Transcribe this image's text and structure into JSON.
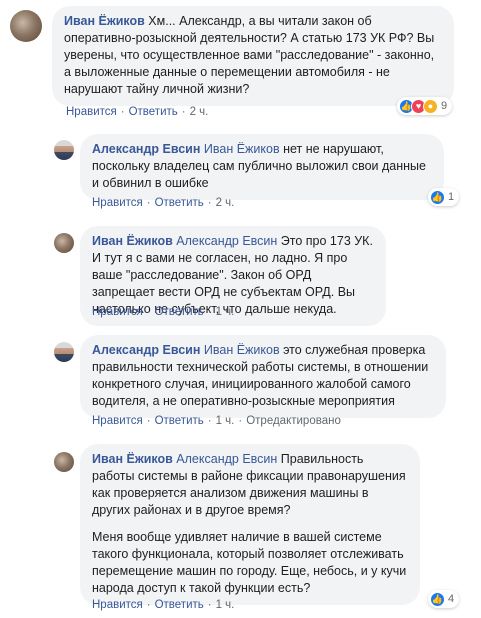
{
  "comments": [
    {
      "author": "Иван Ёжиков",
      "mention": "",
      "text": "Хм... Александр, а вы читали закон об оперативно-розыскной деятельности? А статью 173 УК РФ? Вы уверены, что осуществленное вами \"расследование\" - законно, а выложенные данные о перемещении автомобиля - не нарушают тайну личной жизни?",
      "text2": "",
      "like": "Нравится",
      "reply": "Ответить",
      "time": "2 ч.",
      "edited": "",
      "reaction_count": "9",
      "reactions": [
        "like-icon",
        "love-icon",
        "wow-icon"
      ]
    },
    {
      "author": "Александр Евсин",
      "mention": "Иван Ёжиков",
      "text": " нет не нарушают, поскольку владелец сам публично выложил свои данные и обвинил в ошибке",
      "text2": "",
      "like": "Нравится",
      "reply": "Ответить",
      "time": "2 ч.",
      "edited": "",
      "reaction_count": "1",
      "reactions": [
        "like-icon"
      ]
    },
    {
      "author": "Иван Ёжиков",
      "mention": "Александр Евсин",
      "text": " Это про 173 УК. И тут я с вами не согласен, но ладно. Я про ваше \"расследование\". Закон об ОРД запрещает вести ОРД не субъектам ОРД. Вы настолько не субъект, что дальше некуда.",
      "text2": "",
      "like": "Нравится",
      "reply": "Ответить",
      "time": "1 ч.",
      "edited": "",
      "reaction_count": "",
      "reactions": []
    },
    {
      "author": "Александр Евсин",
      "mention": "Иван Ёжиков",
      "text": " это служебная проверка правильности технической работы системы, в отношении конкретного случая, инициированного жалобой самого водителя, а не оперативно-розыскные мероприятия",
      "text2": "",
      "like": "Нравится",
      "reply": "Ответить",
      "time": "1 ч.",
      "edited": "Отредактировано",
      "reaction_count": "",
      "reactions": []
    },
    {
      "author": "Иван Ёжиков",
      "mention": "Александр Евсин",
      "text": " Правильность работы системы в районе фиксации правонарушения как проверяется анализом движения машины в других районах и в другое время?",
      "text2": "Меня вообще удивляет наличие в вашей системе такого функционала, который позволяет отслеживать перемещение машин по городу. Еще, небось, и у кучи народа доступ к такой функции есть?",
      "like": "Нравится",
      "reply": "Ответить",
      "time": "1 ч.",
      "edited": "",
      "reaction_count": "4",
      "reactions": [
        "like-icon"
      ]
    }
  ]
}
